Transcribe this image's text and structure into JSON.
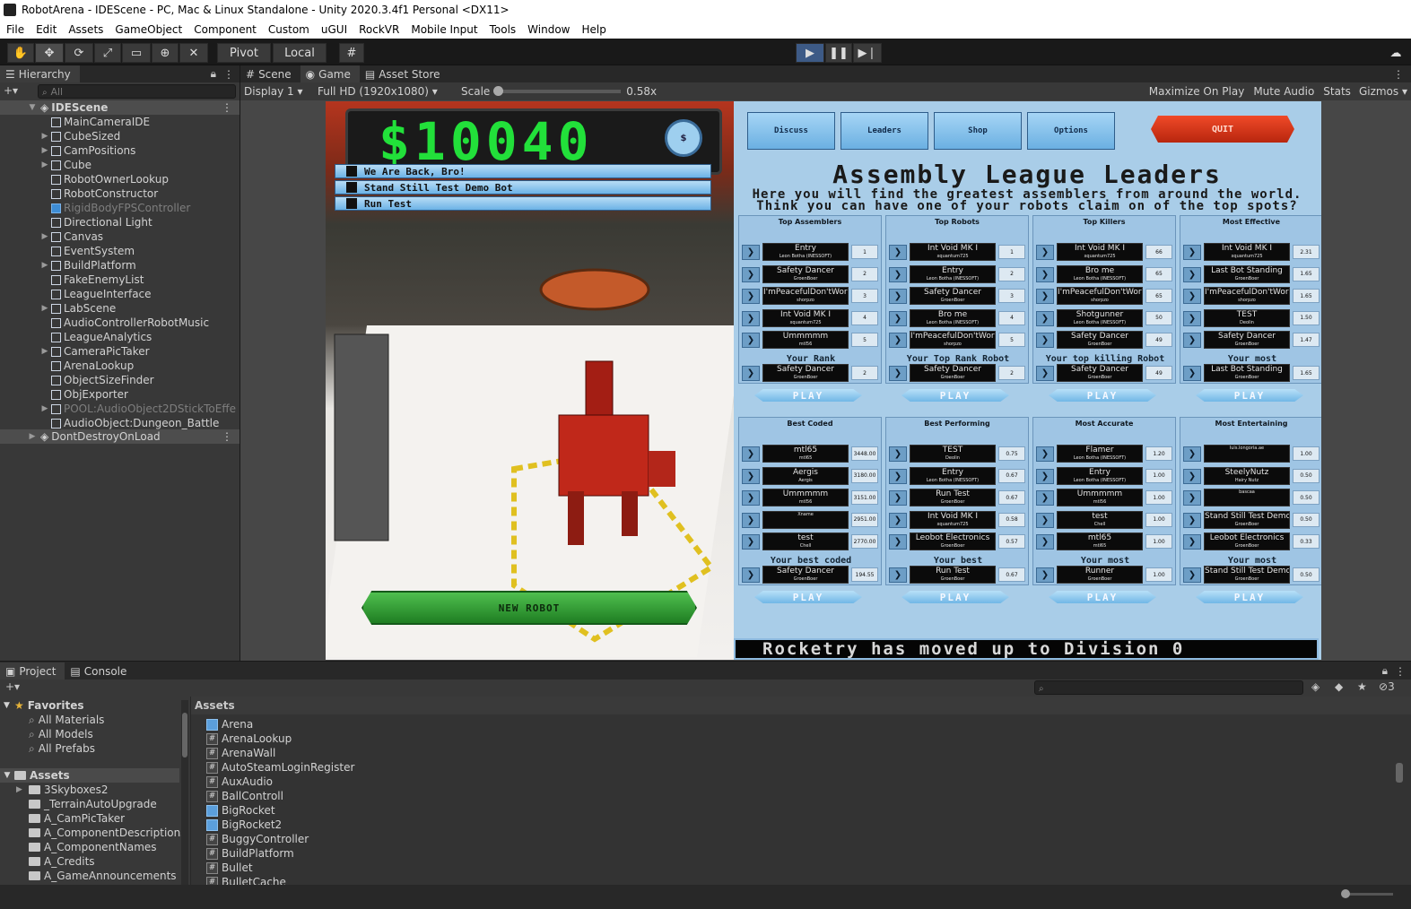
{
  "window": {
    "title": "RobotArena - IDEScene - PC, Mac & Linux Standalone - Unity 2020.3.4f1 Personal <DX11>"
  },
  "menu": [
    "File",
    "Edit",
    "Assets",
    "GameObject",
    "Component",
    "Custom",
    "uGUI",
    "RockVR",
    "Mobile Input",
    "Tools",
    "Window",
    "Help"
  ],
  "toolbar": {
    "pivot": "Pivot",
    "local": "Local"
  },
  "hierarchy": {
    "tab": "Hierarchy",
    "search_placeholder": "All",
    "scene": "IDEScene",
    "items": [
      {
        "label": "MainCameraIDE",
        "arrow": false,
        "dim": false
      },
      {
        "label": "CubeSized",
        "arrow": true,
        "dim": false
      },
      {
        "label": "CamPositions",
        "arrow": true,
        "dim": false
      },
      {
        "label": "Cube",
        "arrow": true,
        "dim": false
      },
      {
        "label": "RobotOwnerLookup",
        "arrow": false,
        "dim": false
      },
      {
        "label": "RobotConstructor",
        "arrow": false,
        "dim": false
      },
      {
        "label": "RigidBodyFPSController",
        "arrow": false,
        "dim": true,
        "blue": true
      },
      {
        "label": "Directional Light",
        "arrow": false,
        "dim": false
      },
      {
        "label": "Canvas",
        "arrow": true,
        "dim": false
      },
      {
        "label": "EventSystem",
        "arrow": false,
        "dim": false
      },
      {
        "label": "BuildPlatform",
        "arrow": true,
        "dim": false
      },
      {
        "label": "FakeEnemyList",
        "arrow": false,
        "dim": false
      },
      {
        "label": "LeagueInterface",
        "arrow": false,
        "dim": false
      },
      {
        "label": "LabScene",
        "arrow": true,
        "dim": false
      },
      {
        "label": "AudioControllerRobotMusic",
        "arrow": false,
        "dim": false
      },
      {
        "label": "LeagueAnalytics",
        "arrow": false,
        "dim": false
      },
      {
        "label": "CameraPicTaker",
        "arrow": true,
        "dim": false
      },
      {
        "label": "ArenaLookup",
        "arrow": false,
        "dim": false
      },
      {
        "label": "ObjectSizeFinder",
        "arrow": false,
        "dim": false
      },
      {
        "label": "ObjExporter",
        "arrow": false,
        "dim": false
      },
      {
        "label": "POOL:AudioObject2DStickToEffe",
        "arrow": true,
        "dim": true
      },
      {
        "label": "AudioObject:Dungeon_Battle",
        "arrow": false,
        "dim": false
      }
    ],
    "dontdestroy": "DontDestroyOnLoad"
  },
  "tabs": {
    "scene": "Scene",
    "game": "Game",
    "asset_store": "Asset Store"
  },
  "gamebar": {
    "display": "Display 1",
    "resolution": "Full HD (1920x1080)",
    "scale_label": "Scale",
    "scale_value": "0.58x",
    "maximize": "Maximize On Play",
    "mute": "Mute Audio",
    "stats": "Stats",
    "gizmos": "Gizmos"
  },
  "game": {
    "money": "$10040",
    "dollar_btn": "$",
    "robots": [
      "We Are Back, Bro!",
      "Stand Still Test Demo Bot",
      "Run Test"
    ],
    "new_robot": "NEW ROBOT",
    "nav": [
      "Discuss",
      "Leaders",
      "Shop",
      "Options"
    ],
    "quit": "QUIT",
    "league_title": "Assembly League Leaders",
    "league_desc": "Here you will find the greatest assemblers from around the world. Think you can have one of your robots claim on of the top spots?",
    "play": "PLAY",
    "ticker": "Rocketry has moved up to Division 0",
    "cards": [
      {
        "title": "Top Assemblers",
        "rows": [
          [
            "Entry",
            "Leon Botha (INESSOFT)",
            "1"
          ],
          [
            "Safety Dancer",
            "GroenBoer",
            "2"
          ],
          [
            "I'mPeacefulDon'tWorry",
            "shorpzo",
            "3"
          ],
          [
            "Int Void MK I",
            "xquantum725",
            "4"
          ],
          [
            "Ummmmm",
            "mtl56",
            "5"
          ]
        ],
        "your": "Your Rank",
        "yours": [
          "Safety Dancer",
          "GroenBoer",
          "2"
        ]
      },
      {
        "title": "Top Robots",
        "rows": [
          [
            "Int Void MK I",
            "xquantum725",
            "1"
          ],
          [
            "Entry",
            "Leon Botha (INESSOFT)",
            "2"
          ],
          [
            "Safety Dancer",
            "GroenBoer",
            "3"
          ],
          [
            "Bro me",
            "Leon Botha (INESSOFT)",
            "4"
          ],
          [
            "I'mPeacefulDon'tWorry",
            "shorpzo",
            "5"
          ]
        ],
        "your": "Your Top Rank Robot",
        "yours": [
          "Safety Dancer",
          "GroenBoer",
          "2"
        ]
      },
      {
        "title": "Top Killers",
        "rows": [
          [
            "Int Void MK I",
            "xquantum725",
            "66"
          ],
          [
            "Bro me",
            "Leon Botha (INESSOFT)",
            "65"
          ],
          [
            "I'mPeacefulDon'tWorry",
            "shorpzo",
            "65"
          ],
          [
            "Shotgunner",
            "Leon Botha (INESSOFT)",
            "50"
          ],
          [
            "Safety Dancer",
            "GroenBoer",
            "49"
          ]
        ],
        "your": "Your top killing Robot",
        "yours": [
          "Safety Dancer",
          "GroenBoer",
          "49"
        ]
      },
      {
        "title": "Most Effective",
        "rows": [
          [
            "Int Void MK I",
            "xquantum725",
            "2.31"
          ],
          [
            "Last Bot Standing",
            "GroenBoer",
            "1.65"
          ],
          [
            "I'mPeacefulDon'tWorry",
            "shorpzo",
            "1.65"
          ],
          [
            "TEST",
            "Deolin",
            "1.50"
          ],
          [
            "Safety Dancer",
            "GroenBoer",
            "1.47"
          ]
        ],
        "your": "Your most",
        "yours": [
          "Last Bot Standing",
          "GroenBoer",
          "1.65"
        ]
      },
      {
        "title": "Best Coded",
        "rows": [
          [
            "mtl65",
            "mtl65",
            "3448.00"
          ],
          [
            "Aergis",
            "Aergis",
            "3180.00"
          ],
          [
            "Ummmmm",
            "mtl56",
            "3151.00"
          ],
          [
            "",
            "Xname",
            "2951.00"
          ],
          [
            "test",
            "Chell",
            "2770.00"
          ]
        ],
        "your": "Your best coded",
        "yours": [
          "Safety Dancer",
          "GroenBoer",
          "194.55"
        ]
      },
      {
        "title": "Best Performing",
        "rows": [
          [
            "TEST",
            "Deolin",
            "0.75"
          ],
          [
            "Entry",
            "Leon Botha (INESSOFT)",
            "0.67"
          ],
          [
            "Run Test",
            "GroenBoer",
            "0.67"
          ],
          [
            "Int Void MK I",
            "xquantum725",
            "0.58"
          ],
          [
            "Leobot Electronics",
            "GroenBoer",
            "0.57"
          ]
        ],
        "your": "Your best",
        "yours": [
          "Run Test",
          "GroenBoer",
          "0.67"
        ]
      },
      {
        "title": "Most Accurate",
        "rows": [
          [
            "Flamer",
            "Leon Botha (INESSOFT)",
            "1.20"
          ],
          [
            "Entry",
            "Leon Botha (INESSOFT)",
            "1.00"
          ],
          [
            "Ummmmm",
            "mtl56",
            "1.00"
          ],
          [
            "test",
            "Chell",
            "1.00"
          ],
          [
            "mtl65",
            "mtl65",
            "1.00"
          ]
        ],
        "your": "Your most",
        "yours": [
          "Runner",
          "GroenBoer",
          "1.00"
        ]
      },
      {
        "title": "Most Entertaining",
        "rows": [
          [
            "",
            "luis.longoria.ae",
            "1.00"
          ],
          [
            "SteelyNutz",
            "Hairy Nutz",
            "0.50"
          ],
          [
            "",
            "bascaa",
            "0.50"
          ],
          [
            "Stand Still Test Demo Bot",
            "GroenBoer",
            "0.50"
          ],
          [
            "Leobot Electronics",
            "GroenBoer",
            "0.33"
          ]
        ],
        "your": "Your most",
        "yours": [
          "Stand Still Test Demo Bot",
          "GroenBoer",
          "0.50"
        ]
      }
    ]
  },
  "bottom": {
    "project_tab": "Project",
    "console_tab": "Console",
    "favorites": "Favorites",
    "fav_items": [
      "All Materials",
      "All Models",
      "All Prefabs"
    ],
    "assets_label": "Assets",
    "asset_folders": [
      "3Skyboxes2",
      "_TerrainAutoUpgrade",
      "A_CamPicTaker",
      "A_ComponentDescriptions",
      "A_ComponentNames",
      "A_Credits",
      "A_GameAnnouncements",
      "A_GameIntro"
    ],
    "assets_header": "Assets",
    "asset_items": [
      {
        "label": "Arena",
        "type": "prefab"
      },
      {
        "label": "ArenaLookup",
        "type": "cs"
      },
      {
        "label": "ArenaWall",
        "type": "cs"
      },
      {
        "label": "AutoSteamLoginRegister",
        "type": "cs"
      },
      {
        "label": "AuxAudio",
        "type": "cs"
      },
      {
        "label": "BallControll",
        "type": "cs"
      },
      {
        "label": "BigRocket",
        "type": "prefab"
      },
      {
        "label": "BigRocket2",
        "type": "prefab"
      },
      {
        "label": "BuggyController",
        "type": "cs"
      },
      {
        "label": "BuildPlatform",
        "type": "cs"
      },
      {
        "label": "Bullet",
        "type": "cs"
      },
      {
        "label": "BulletCache",
        "type": "cs"
      }
    ],
    "hidden_count": "3"
  }
}
